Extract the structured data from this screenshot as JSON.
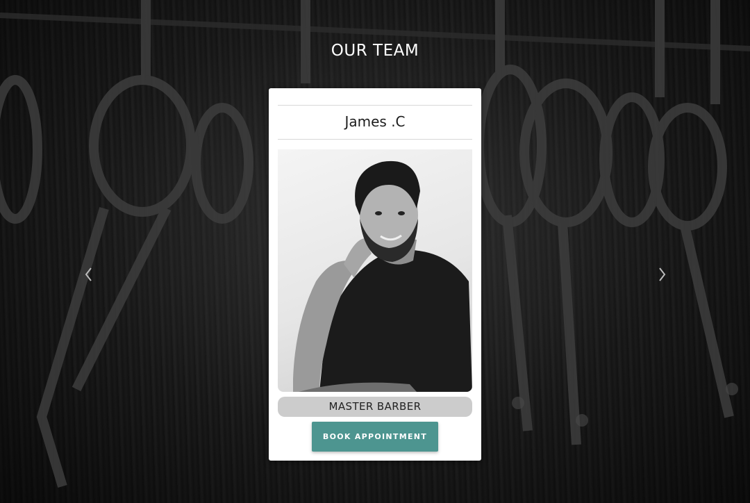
{
  "section": {
    "title": "OUR TEAM"
  },
  "carousel": {
    "prev_icon": "chevron-left-icon",
    "next_icon": "chevron-right-icon"
  },
  "member": {
    "name": "James .C",
    "role": "MASTER BARBER",
    "photo_description_icon": "portrait-photo",
    "book_label": "BOOK APPOINTMENT"
  },
  "colors": {
    "accent": "#4d9590",
    "badge": "#cccccc",
    "card": "#ffffff",
    "background": "#141414"
  }
}
